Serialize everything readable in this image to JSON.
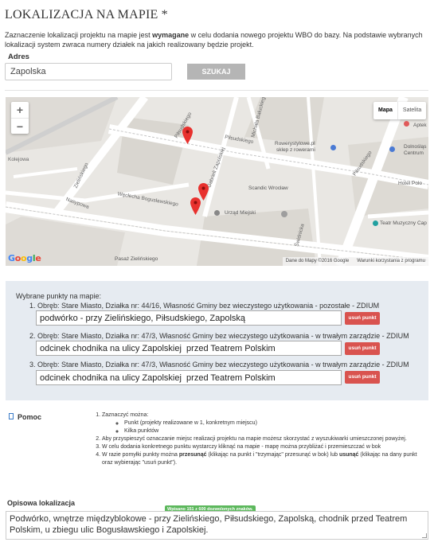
{
  "section": {
    "title": "LOKALIZACJA NA MAPIE *",
    "intro_before": "Zaznaczenie lokalizacji projektu na mapie jest ",
    "intro_bold": "wymagane",
    "intro_after": " w celu dodania nowego projektu WBO do bazy. Na podstawie wybranych lokalizacji system zwraca numery działek na jakich realizowany będzie projekt."
  },
  "address": {
    "label": "Adres",
    "value": "Zapolska",
    "search_label": "SZUKAJ"
  },
  "map": {
    "zoom_in": "+",
    "zoom_out": "−",
    "type_map": "Mapa",
    "type_satellite": "Satelita",
    "footer_data": "Dane do Mapy ©2016 Google",
    "footer_terms": "Warunki korzystania z programu",
    "labels": {
      "rowerystylowe": "Rowerystylowe.pl",
      "rowerystylowe2": "sklep z rowerami",
      "scandic": "Scandic Wrocław",
      "urzad": "Urząd Miejski",
      "teatr": "Teatr Muzyczny Cap",
      "hotel": "Hotel Polo",
      "dolnoslaska": "Dolnośląs",
      "centrum": "Centrum",
      "apteka": "Aptek",
      "pasaz": "Pasaż Zielińskiego",
      "pilsudskiego1": "Piłsudskiego",
      "pilsudskiego2": "Piłsudskiego",
      "pilsudskiego3": "Piłsudskiego",
      "zielinskiego": "Zielińskiego",
      "wiecbia": "Węcłecha Bogusławskiego",
      "nasypowa": "Nasypowa",
      "kolejowa": "Kolejowa",
      "zapolskiej": "Gabrieli Zapolskiej",
      "michala": "Michała Bałuckiego",
      "swidnicka": "Świdnicka"
    },
    "icons": [
      "zoom-in-icon",
      "zoom-out-icon",
      "map-marker-icon"
    ]
  },
  "points": {
    "title": "Wybrane punkty na mapie:",
    "remove_label": "usuń punkt",
    "items": [
      {
        "desc": "1. Obręb: Stare Miasto, Działka nr: 44/16, Własność Gminy bez wieczystego użytkowania - pozostałe - ZDIUM",
        "value": "podwórko - przy Zielińskiego, Piłsudskiego, Zapolską"
      },
      {
        "desc": "2. Obręb: Stare Miasto, Działka nr: 47/3, Własność Gminy bez wieczystego użytkowania - w trwałym zarządzie - ZDIUM",
        "value": "odcinek chodnika na ulicy Zapolskiej  przed Teatrem Polskim"
      },
      {
        "desc": "3. Obręb: Stare Miasto, Działka nr: 47/3, Własność Gminy bez wieczystego użytkowania - w trwałym zarządzie - ZDIUM",
        "value": "odcinek chodnika na ulicy Zapolskiej  przed Teatrem Polskim"
      }
    ]
  },
  "help": {
    "label": "Pomoc",
    "item1": "Zaznaczyć można:",
    "item1a": "Punkt (projekty realizowane w 1, konkretnym miejscu)",
    "item1b": "Kilka punktów",
    "item2": "Aby przyspieszyć oznaczanie miejsc realizacji projektu na mapie możesz skorzystać z wyszukiwarki umieszczonej powyżej.",
    "item3": "W celu dodania konkretnego punktu wystarczy kliknąć na mapie - mapę można przybliżać i przemieszczać w bok",
    "item4_a": "W razie pomyłki punkty można ",
    "item4_b": "przesunąć",
    "item4_c": " (klikając na punkt i \"trzymając\" przesunąć w bok) lub ",
    "item4_d": "usunąć",
    "item4_e": " (klikając na dany punkt oraz wybierając \"usuń punkt\")."
  },
  "description": {
    "label": "Opisowa lokalizacja",
    "counter": "Wpisano 151 z 600 dozwolonych znaków.",
    "value": "Podwórko, wnętrze międzyblokowe  - przy Zielińskiego, Piłsudskiego, Zapolską, chodnik przed Teatrem Polskim, u zbiegu ulic Bogusławskiego i Zapolskiej."
  },
  "colors": {
    "remove_button": "#d9534f",
    "search_button": "#b5b5b5",
    "points_panel": "#e6ebf1",
    "counter_badge": "#5cb85c",
    "marker": "#e8312e"
  }
}
